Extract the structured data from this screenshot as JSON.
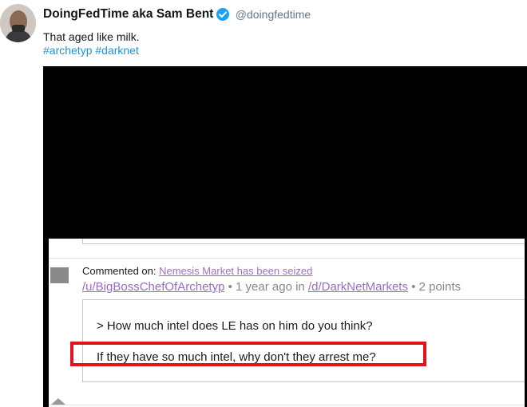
{
  "tweet": {
    "display_name": "DoingFedTime aka Sam Bent",
    "verified_icon": "verified-badge-icon",
    "handle": "@doingfedtime",
    "text": "That aged like milk.",
    "hashtags": [
      "#archetyp",
      "#darknet"
    ]
  },
  "screenshot": {
    "commented_label": "Commented on:",
    "post_title": "Nemesis Market has been seized",
    "author": "/u/BigBossChefOfArchetyp",
    "time_text": "1 year ago in",
    "subreddit": "/d/DarkNetMarkets",
    "points": "2 points",
    "separator": "•",
    "quote": "> How much intel does LE has on him do you think?",
    "reply": "If they have so much intel, why don't they arrest me?"
  },
  "colors": {
    "link_blue": "#1b95e0",
    "verified_blue": "#1da1f2",
    "link_purple": "#a070c4",
    "highlight_red": "#e3131b"
  }
}
